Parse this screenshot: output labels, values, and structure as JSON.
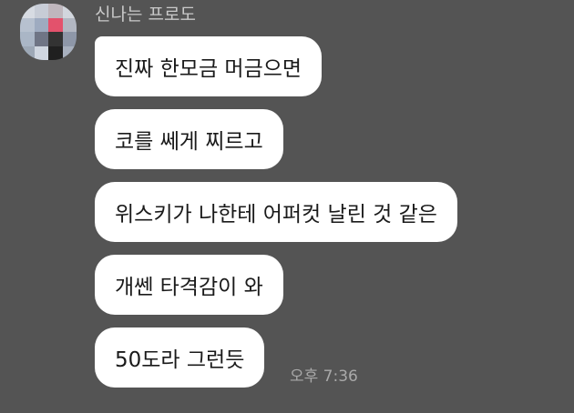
{
  "chat": {
    "sender_name": "신나는 프로도",
    "messages": [
      {
        "text": "진짜 한모금 머금으면"
      },
      {
        "text": "코를 쎄게 찌르고"
      },
      {
        "text": "위스키가 나한테 어퍼컷 날린 것 같은"
      },
      {
        "text": "개쎈 타격감이 와"
      },
      {
        "text": "50도라 그런듯"
      }
    ],
    "timestamp": "오후 7:36"
  },
  "colors": {
    "background": "#545454",
    "bubble": "#ffffff",
    "message_text": "#1a1a1a",
    "sender_name": "#c9c9c9",
    "timestamp": "#a9a9a9"
  },
  "avatar": {
    "icon": "pixelated-profile-avatar-icon"
  }
}
